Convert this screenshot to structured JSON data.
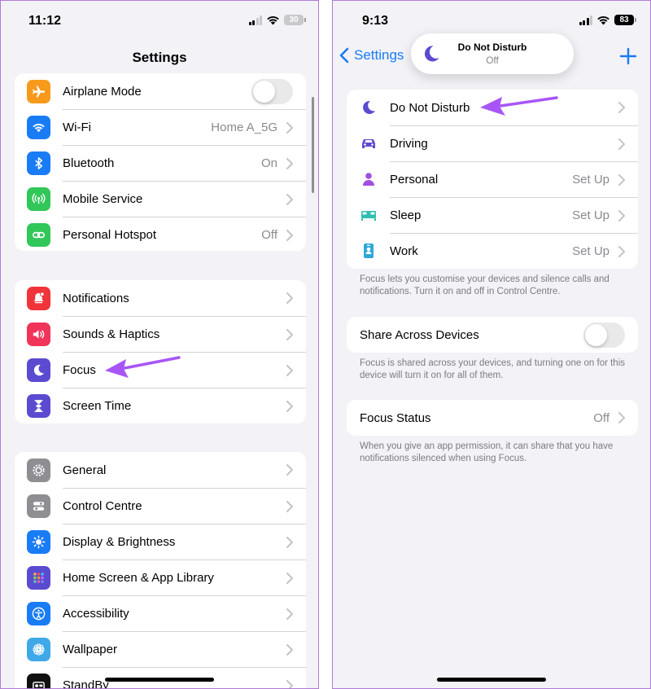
{
  "left": {
    "status": {
      "time": "11:12",
      "battery": "30"
    },
    "title": "Settings",
    "groups": [
      [
        {
          "label": "Airplane Mode",
          "icon": "airplane-icon",
          "color": "#f79a1b",
          "toggle": false
        },
        {
          "label": "Wi-Fi",
          "value": "Home A_5G",
          "icon": "wifi-icon",
          "color": "#1a7cf5"
        },
        {
          "label": "Bluetooth",
          "value": "On",
          "icon": "bluetooth-icon",
          "color": "#1a7cf5"
        },
        {
          "label": "Mobile Service",
          "icon": "antenna-icon",
          "color": "#32c759"
        },
        {
          "label": "Personal Hotspot",
          "value": "Off",
          "icon": "hotspot-icon",
          "color": "#32c759"
        }
      ],
      [
        {
          "label": "Notifications",
          "icon": "bell-icon",
          "color": "#f0343a"
        },
        {
          "label": "Sounds & Haptics",
          "icon": "speaker-icon",
          "color": "#f0345a"
        },
        {
          "label": "Focus",
          "icon": "moon-icon",
          "color": "#5b4bd0"
        },
        {
          "label": "Screen Time",
          "icon": "hourglass-icon",
          "color": "#5b4bd0"
        }
      ],
      [
        {
          "label": "General",
          "icon": "gear-icon",
          "color": "#8e8e93"
        },
        {
          "label": "Control Centre",
          "icon": "switches-icon",
          "color": "#8e8e93"
        },
        {
          "label": "Display & Brightness",
          "icon": "sun-icon",
          "color": "#1a7cf5"
        },
        {
          "label": "Home Screen & App Library",
          "icon": "grid-icon",
          "color": "#5b4bd0"
        },
        {
          "label": "Accessibility",
          "icon": "accessibility-icon",
          "color": "#1a7cf5"
        },
        {
          "label": "Wallpaper",
          "icon": "flower-icon",
          "color": "#3fa8e8"
        },
        {
          "label": "StandBy",
          "icon": "standby-icon",
          "color": "#111111"
        }
      ]
    ]
  },
  "right": {
    "status": {
      "time": "9:13",
      "battery": "83"
    },
    "back_label": "Settings",
    "toast": {
      "title": "Do Not Disturb",
      "subtitle": "Off"
    },
    "focus_modes": [
      {
        "label": "Do Not Disturb",
        "value": "",
        "icon": "moon-icon",
        "color": "#5b4bd0"
      },
      {
        "label": "Driving",
        "value": "",
        "icon": "car-icon",
        "color": "#5b4bd0"
      },
      {
        "label": "Personal",
        "value": "Set Up",
        "icon": "person-icon",
        "color": "#a24fe0"
      },
      {
        "label": "Sleep",
        "value": "Set Up",
        "icon": "bed-icon",
        "color": "#2fbfb0"
      },
      {
        "label": "Work",
        "value": "Set Up",
        "icon": "badge-icon",
        "color": "#2fa8d8"
      }
    ],
    "focus_note": "Focus lets you customise your devices and silence calls and notifications. Turn it on and off in Control Centre.",
    "share": {
      "label": "Share Across Devices",
      "toggle": false
    },
    "share_note": "Focus is shared across your devices, and turning one on for this device will turn it on for all of them.",
    "status_row": {
      "label": "Focus Status",
      "value": "Off"
    },
    "status_note": "When you give an app permission, it can share that you have notifications silenced when using Focus.",
    "accent": "#1a7cf5",
    "arrow_color": "#a855f7"
  }
}
